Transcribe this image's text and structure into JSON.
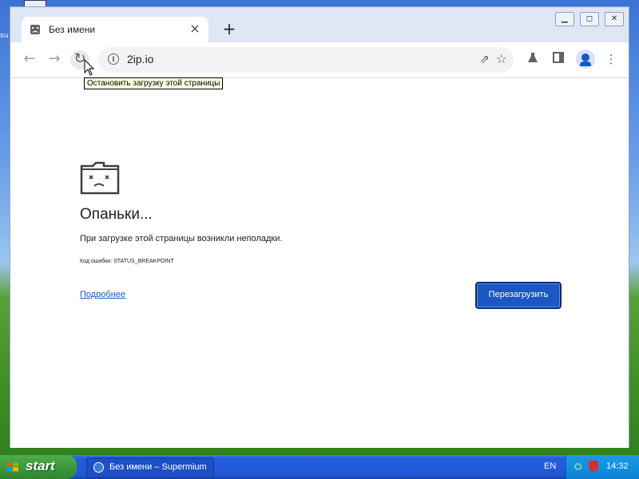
{
  "desktop": {
    "label": "su"
  },
  "window": {
    "controls": {
      "minimize": "▁",
      "maximize": "◻",
      "close": "✕"
    }
  },
  "tab": {
    "title": "Без имени",
    "close": "×",
    "new_tab": "+"
  },
  "toolbar": {
    "back": "←",
    "forward": "→",
    "reload": "↻",
    "url": "2ip.io",
    "share_icon": "share-icon",
    "star_icon": "star-icon"
  },
  "tooltip": {
    "text": "Остановить загрузку этой страницы"
  },
  "error_page": {
    "title": "Опаньки...",
    "description": "При загрузке этой страницы возникли неполадки.",
    "code": "Код ошибки: STATUS_BREAKPOINT",
    "more_link": "Подробнее",
    "reload_button": "Перезагрузить"
  },
  "taskbar": {
    "start": "start",
    "task_item": "Без имени – Supermium",
    "language": "EN",
    "clock": "14:32"
  },
  "colors": {
    "accent": "#1a56c4",
    "taskbar": "#2157d6",
    "start": "#3c9a3c"
  }
}
